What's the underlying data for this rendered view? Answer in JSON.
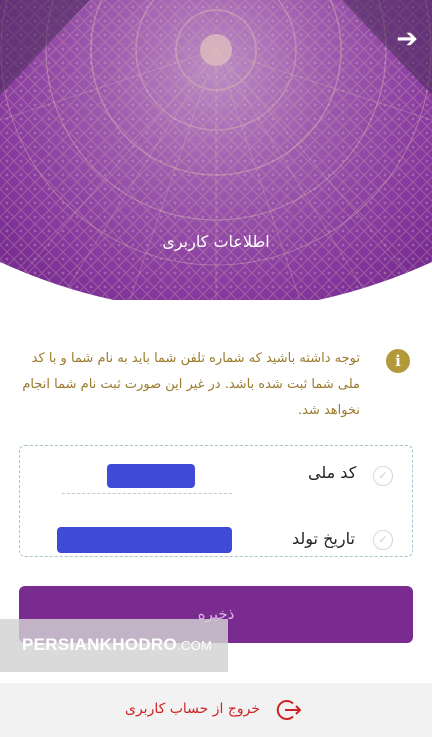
{
  "header": {
    "title": "اطلاعات کاربری",
    "back_icon": "arrow-right-icon",
    "colors": {
      "purple_dark": "#5a1f79",
      "purple_light": "#9c3fb0",
      "tile_gold": "#c19766"
    }
  },
  "notice": {
    "icon": "info-icon",
    "icon_glyph": "i",
    "text": "توجه داشته باشید که شماره تلفن شما باید به نام شما و با کد ملی شما ثبت شده باشد. در غیر این صورت ثبت نام شما انجام نخواهد شد."
  },
  "form": {
    "national_code": {
      "label": "کد ملی",
      "icon": "check-circle-icon"
    },
    "birth_date": {
      "label": "تاریخ تولد",
      "icon": "check-circle-icon"
    },
    "field_fill_color": "#3f4bd6"
  },
  "save_button": {
    "label": "ذخیره",
    "color": "#7a2b8f"
  },
  "watermark": {
    "brand": "PERSIANKHODRO",
    "suffix": ".COM"
  },
  "footer": {
    "logout_label": "خروج از حساب کاربری",
    "logout_icon": "logout-icon",
    "color": "#cf2323"
  }
}
